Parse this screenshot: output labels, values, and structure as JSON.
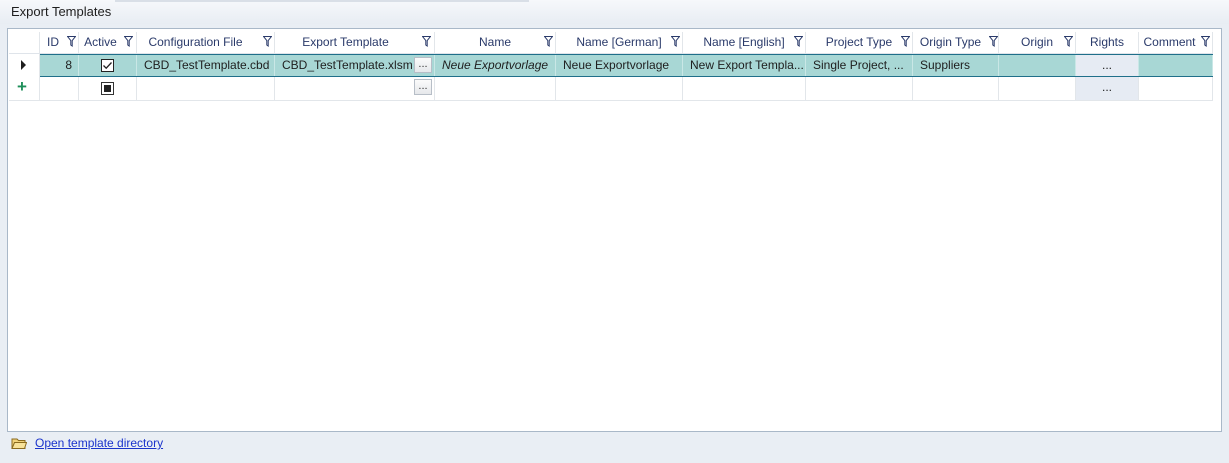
{
  "window": {
    "title": "Export Templates"
  },
  "columns": [
    {
      "key": "id",
      "label": "ID"
    },
    {
      "key": "active",
      "label": "Active"
    },
    {
      "key": "config_file",
      "label": "Configuration File"
    },
    {
      "key": "export_template",
      "label": "Export Template"
    },
    {
      "key": "name",
      "label": "Name"
    },
    {
      "key": "name_german",
      "label": "Name [German]"
    },
    {
      "key": "name_english",
      "label": "Name [English]"
    },
    {
      "key": "project_type",
      "label": "Project Type"
    },
    {
      "key": "origin_type",
      "label": "Origin Type"
    },
    {
      "key": "origin",
      "label": "Origin"
    },
    {
      "key": "rights",
      "label": "Rights"
    },
    {
      "key": "comment",
      "label": "Comment"
    }
  ],
  "rows": [
    {
      "id": "8",
      "active": true,
      "config_file": "CBD_TestTemplate.cbd",
      "export_template": "CBD_TestTemplate.xlsm",
      "export_template_button": "...",
      "name": "Neue Exportvorlage",
      "name_german": "Neue Exportvorlage",
      "name_english": "New Export Templa...",
      "project_type": "Single Project, ...",
      "origin_type": "Suppliers",
      "origin": "",
      "rights_button": "...",
      "comment": ""
    }
  ],
  "new_row": {
    "indicator": "+",
    "export_template_button": "...",
    "rights_button": "..."
  },
  "footer": {
    "link": "Open template directory"
  },
  "colors": {
    "selected_row": "#a8d7d5",
    "selected_border": "#1f6f8a",
    "header_text": "#2a3a6a",
    "link": "#1a33cc"
  },
  "icons": {
    "row_indicator": "triangle-right-icon",
    "filter": "filter-icon",
    "footer": "folder-icon"
  }
}
